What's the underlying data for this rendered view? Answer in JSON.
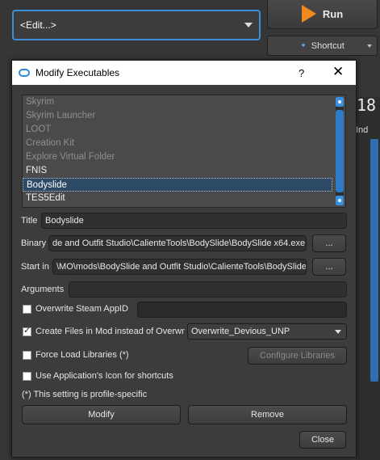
{
  "background": {
    "profile_combo": "<Edit...>",
    "run_label": "Run",
    "shortcut_label": "Shortcut",
    "side_column_header": "Ind",
    "side_number": "18"
  },
  "dialog": {
    "title": "Modify Executables",
    "help": "?",
    "close": "✕",
    "executables": [
      {
        "label": "Skyrim",
        "state": "disabled"
      },
      {
        "label": "Skyrim Launcher",
        "state": "disabled"
      },
      {
        "label": "LOOT",
        "state": "disabled"
      },
      {
        "label": "Creation Kit",
        "state": "disabled"
      },
      {
        "label": "Explore Virtual Folder",
        "state": "disabled"
      },
      {
        "label": "FNIS",
        "state": "enabled"
      },
      {
        "label": "Bodyslide",
        "state": "selected"
      },
      {
        "label": "TES5Edit",
        "state": "enabled"
      }
    ],
    "title_label": "Title",
    "title_value": "Bodyslide",
    "binary_label": "Binary",
    "binary_value": "de and Outfit Studio\\CalienteTools\\BodySlide\\BodySlide x64.exe",
    "browse_label": "...",
    "startin_label": "Start in",
    "startin_value": "\\MO\\mods\\BodySlide and Outfit Studio\\CalienteTools\\BodySlide",
    "arguments_label": "Arguments",
    "arguments_value": "",
    "overwrite_steam_label": "Overwrite Steam AppID",
    "overwrite_steam_checked": false,
    "steam_appid_value": "",
    "create_files_label": "Create Files in Mod instead of Overwr",
    "create_files_checked": true,
    "create_files_mod": "Overwrite_Devious_UNP",
    "force_load_label": "Force Load Libraries (*)",
    "force_load_checked": false,
    "configure_libraries_label": "Configure Libraries",
    "use_icon_label": "Use Application's Icon for shortcuts",
    "use_icon_checked": false,
    "profile_note": "(*) This setting is profile-specific",
    "modify_label": "Modify",
    "remove_label": "Remove",
    "close_label": "Close"
  },
  "colors": {
    "accent": "#3b8fd6",
    "run_icon": "#f08a1e",
    "selection": "#2c4a66"
  }
}
